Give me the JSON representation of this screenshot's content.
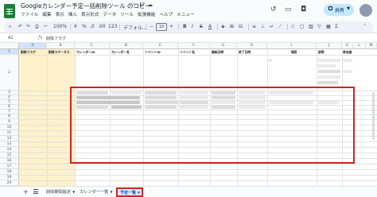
{
  "app": {
    "title": "Googleカレンダー予定一括削除ツール のコピー",
    "menu": [
      "ファイル",
      "編集",
      "表示",
      "挿入",
      "表示形式",
      "データ",
      "ツール",
      "拡張機能",
      "ヘルプ",
      "メニュー"
    ],
    "share_label": "共有"
  },
  "toolbar": {
    "zoom": "100%",
    "currency": "¥",
    "percent": "%",
    "decimal_dec": ".0",
    "decimal_inc": ".00",
    "format": "123",
    "font": "デフォル…",
    "font_size": "10"
  },
  "formula_bar": {
    "cell": "A1",
    "formula": "削除フラグ"
  },
  "grid": {
    "columns": [
      "A",
      "B",
      "C",
      "D",
      "E",
      "F",
      "G",
      "H",
      "I",
      "J",
      "K",
      "L",
      "M"
    ],
    "rows": [
      "1",
      "2",
      "3",
      "4",
      "5",
      "6",
      "7",
      "8",
      "9",
      "10",
      "11",
      "12",
      "13",
      "14",
      "15",
      "16",
      "17",
      "18",
      "19",
      "20"
    ],
    "headers": [
      "削除フラグ",
      "削除ステータス",
      "カレンダーID",
      "カレンダー名",
      "イベントID",
      "イベント名",
      "開始日時",
      "終了日時",
      "場所",
      "説明",
      "参加者"
    ]
  },
  "sheets": {
    "tabs": [
      "削除期間設定",
      "カレンダー一覧",
      "予定一覧"
    ],
    "active_index": 2
  }
}
